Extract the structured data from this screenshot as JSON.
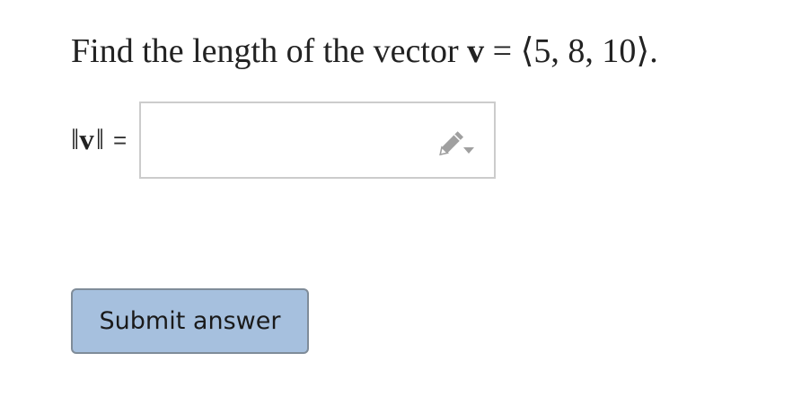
{
  "question": {
    "prefix": "Find the length of the vector ",
    "vector_symbol": "v",
    "equals": " = ",
    "vector_value": "⟨5, 8, 10⟩."
  },
  "answer": {
    "norm_bars_left": "‖",
    "norm_symbol": "v",
    "norm_bars_right": "‖",
    "equals": "=",
    "input_value": "",
    "input_placeholder": "",
    "editor_icon": "pencil-icon"
  },
  "submit_label": "Submit answer",
  "colors": {
    "submit_background": "#a6c0de",
    "submit_border": "#7f8c99",
    "input_border": "#cccccc",
    "pencil_icon": "#a0a0a0"
  }
}
